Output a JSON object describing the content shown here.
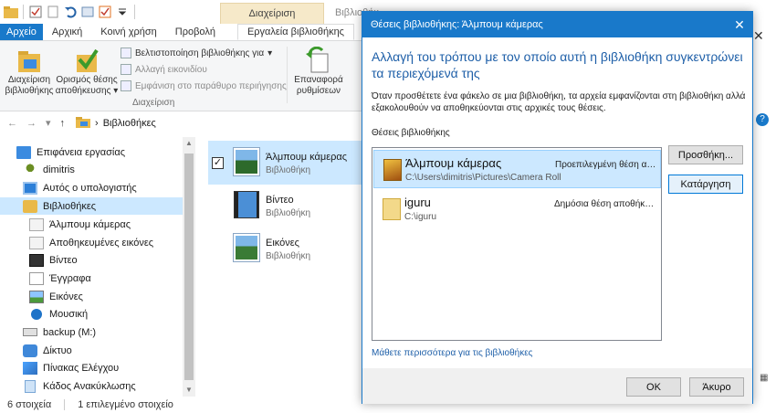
{
  "explorer": {
    "title_partial": "Βιβλιοθήκ",
    "manage_context_header": "Διαχείριση",
    "tabs": [
      {
        "label": "Αρχείο"
      },
      {
        "label": "Αρχική"
      },
      {
        "label": "Κοινή χρήση"
      },
      {
        "label": "Προβολή"
      },
      {
        "label": "Εργαλεία βιβλιοθήκης"
      }
    ],
    "ribbon": {
      "manage_library": "Διαχείριση βιβλιοθήκης",
      "set_save_location": "Ορισμός θέσης αποθήκευσης",
      "optimize_library": "Βελτιστοποίηση βιβλιοθήκης για",
      "change_icon": "Αλλαγή εικονιδίου",
      "show_in_nav": "Εμφάνιση στο παράθυρο περιήγησης",
      "group_label": "Διαχείριση",
      "restore_settings": "Επαναφορά ρυθμίσεων"
    },
    "address": {
      "breadcrumb": "Βιβλιοθήκες"
    },
    "nav_items": [
      {
        "label": "Επιφάνεια εργασίας"
      },
      {
        "label": "dimitris"
      },
      {
        "label": "Αυτός ο υπολογιστής"
      },
      {
        "label": "Βιβλιοθήκες"
      },
      {
        "label": "Άλμπουμ κάμερας"
      },
      {
        "label": "Αποθηκευμένες εικόνες"
      },
      {
        "label": "Βίντεο"
      },
      {
        "label": "Έγγραφα"
      },
      {
        "label": "Εικόνες"
      },
      {
        "label": "Μουσική"
      },
      {
        "label": "backup (M:)"
      },
      {
        "label": "Δίκτυο"
      },
      {
        "label": "Πίνακας Ελέγχου"
      },
      {
        "label": "Κάδος Ανακύκλωσης"
      }
    ],
    "files": [
      {
        "name": "Άλμπουμ κάμερας",
        "type": "Βιβλιοθήκη"
      },
      {
        "name": "Βίντεο",
        "type": "Βιβλιοθήκη"
      },
      {
        "name": "Εικόνες",
        "type": "Βιβλιοθήκη"
      }
    ],
    "status": {
      "items": "6 στοιχεία",
      "selected": "1 επιλεγμένο στοιχείο"
    }
  },
  "dialog": {
    "title": "Θέσεις βιβλιοθήκης: Άλμπουμ κάμερας",
    "heading": "Αλλαγή του τρόπου με τον οποίο αυτή η βιβλιοθήκη συγκεντρώνει τα περιεχόμενά της",
    "description": "Όταν προσθέτετε ένα φάκελο σε μια βιβλιοθήκη, τα αρχεία εμφανίζονται στη βιβλιοθήκη αλλά εξακολουθούν να αποθηκεύονται στις αρχικές τους θέσεις.",
    "list_label": "Θέσεις βιβλιοθήκης",
    "locations": [
      {
        "name": "Άλμπουμ κάμερας",
        "path": "C:\\Users\\dimitris\\Pictures\\Camera Roll",
        "status": "Προεπιλεγμένη θέση αποθήκευσης"
      },
      {
        "name": "iguru",
        "path": "C:\\iguru",
        "status": "Δημόσια θέση αποθήκευσης"
      }
    ],
    "add_button": "Προσθήκη...",
    "remove_button": "Κατάργηση",
    "learn_more_link": "Μάθετε περισσότερα για τις βιβλιοθήκες",
    "ok_button": "OK",
    "cancel_button": "Άκυρο"
  },
  "icons": {
    "folder_color": "#e9b949",
    "accent": "#1979ca",
    "selection": "#cce8ff"
  }
}
